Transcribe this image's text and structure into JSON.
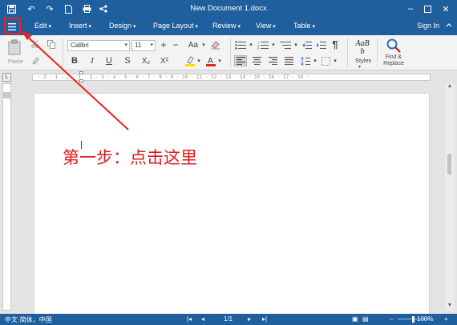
{
  "window": {
    "title": "New Document 1.docx"
  },
  "quick_access": {
    "icons": [
      "save-icon",
      "undo-icon",
      "redo-icon",
      "new-file-icon",
      "print-icon",
      "share-icon"
    ]
  },
  "menu": {
    "items": [
      "Edit",
      "Insert",
      "Design",
      "Page Layout",
      "Review",
      "View",
      "Table"
    ],
    "sign_in": "Sign In"
  },
  "ribbon": {
    "paste_label": "Paste",
    "font_name": "Calibri",
    "font_size": "11",
    "font_size_increase": "+",
    "font_size_decrease": "−",
    "change_case": "Aa",
    "bold": "B",
    "italic": "I",
    "underline": "U",
    "strike": "S",
    "subscript": "X₂",
    "superscript": "X²",
    "pilcrow": "¶",
    "styles_preview": "AaBb",
    "styles_label": "Styles",
    "find_replace_label": "Find & Replace"
  },
  "ruler": {
    "numbers": "· 2 · 1 · | · 1 · 2 · 3 · 4 · 5 · 6 · 7 · 8 · 9 · 10 · 11 · 12 · 13 · 14 · 15 · 16 · 17 · 18 ·"
  },
  "document": {
    "annotation": "第一步：点击这里"
  },
  "status": {
    "language": "中文·简体，中国",
    "page": "1/1",
    "zoom": "100%"
  },
  "colors": {
    "titlebar": "#1f5f9e",
    "annotation": "#e01b1b",
    "highlight_color": "#f2e200",
    "font_color": "#d62828"
  }
}
